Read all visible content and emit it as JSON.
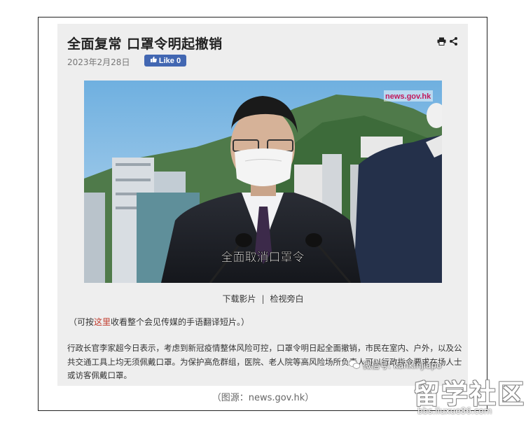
{
  "article": {
    "title": "全面复常 口罩令明起撤销",
    "date": "2023年2月28日",
    "like_label": "Like 0",
    "icons": [
      "print-icon",
      "share-icon"
    ]
  },
  "video": {
    "overlay_logo": "news.gov.hk",
    "subtitle": "全面取消口罩令"
  },
  "links": {
    "download": "下载影片",
    "separator": "|",
    "transcript": "检视旁白"
  },
  "note": {
    "prefix": "（可按",
    "link": "这里",
    "suffix": "收看整个会见传媒的手语翻译短片。）"
  },
  "body": {
    "text": "行政长官李家超今日表示，考虑到新冠疫情整体风险可控，口罩令明日起全面撤销，市民在室内、户外，以及公共交通工具上均无须佩戴口罩。为保护高危群组，医院、老人院等高风险场所负责人可以行政指令要求在场人士或访客佩戴口罩。"
  },
  "caption": "（图源：news.gov.hk）",
  "watermark": {
    "wechat": "微信号: kankinjiapo",
    "site_big": "留学社区",
    "site_url": "bbs.liuxue86.com"
  }
}
